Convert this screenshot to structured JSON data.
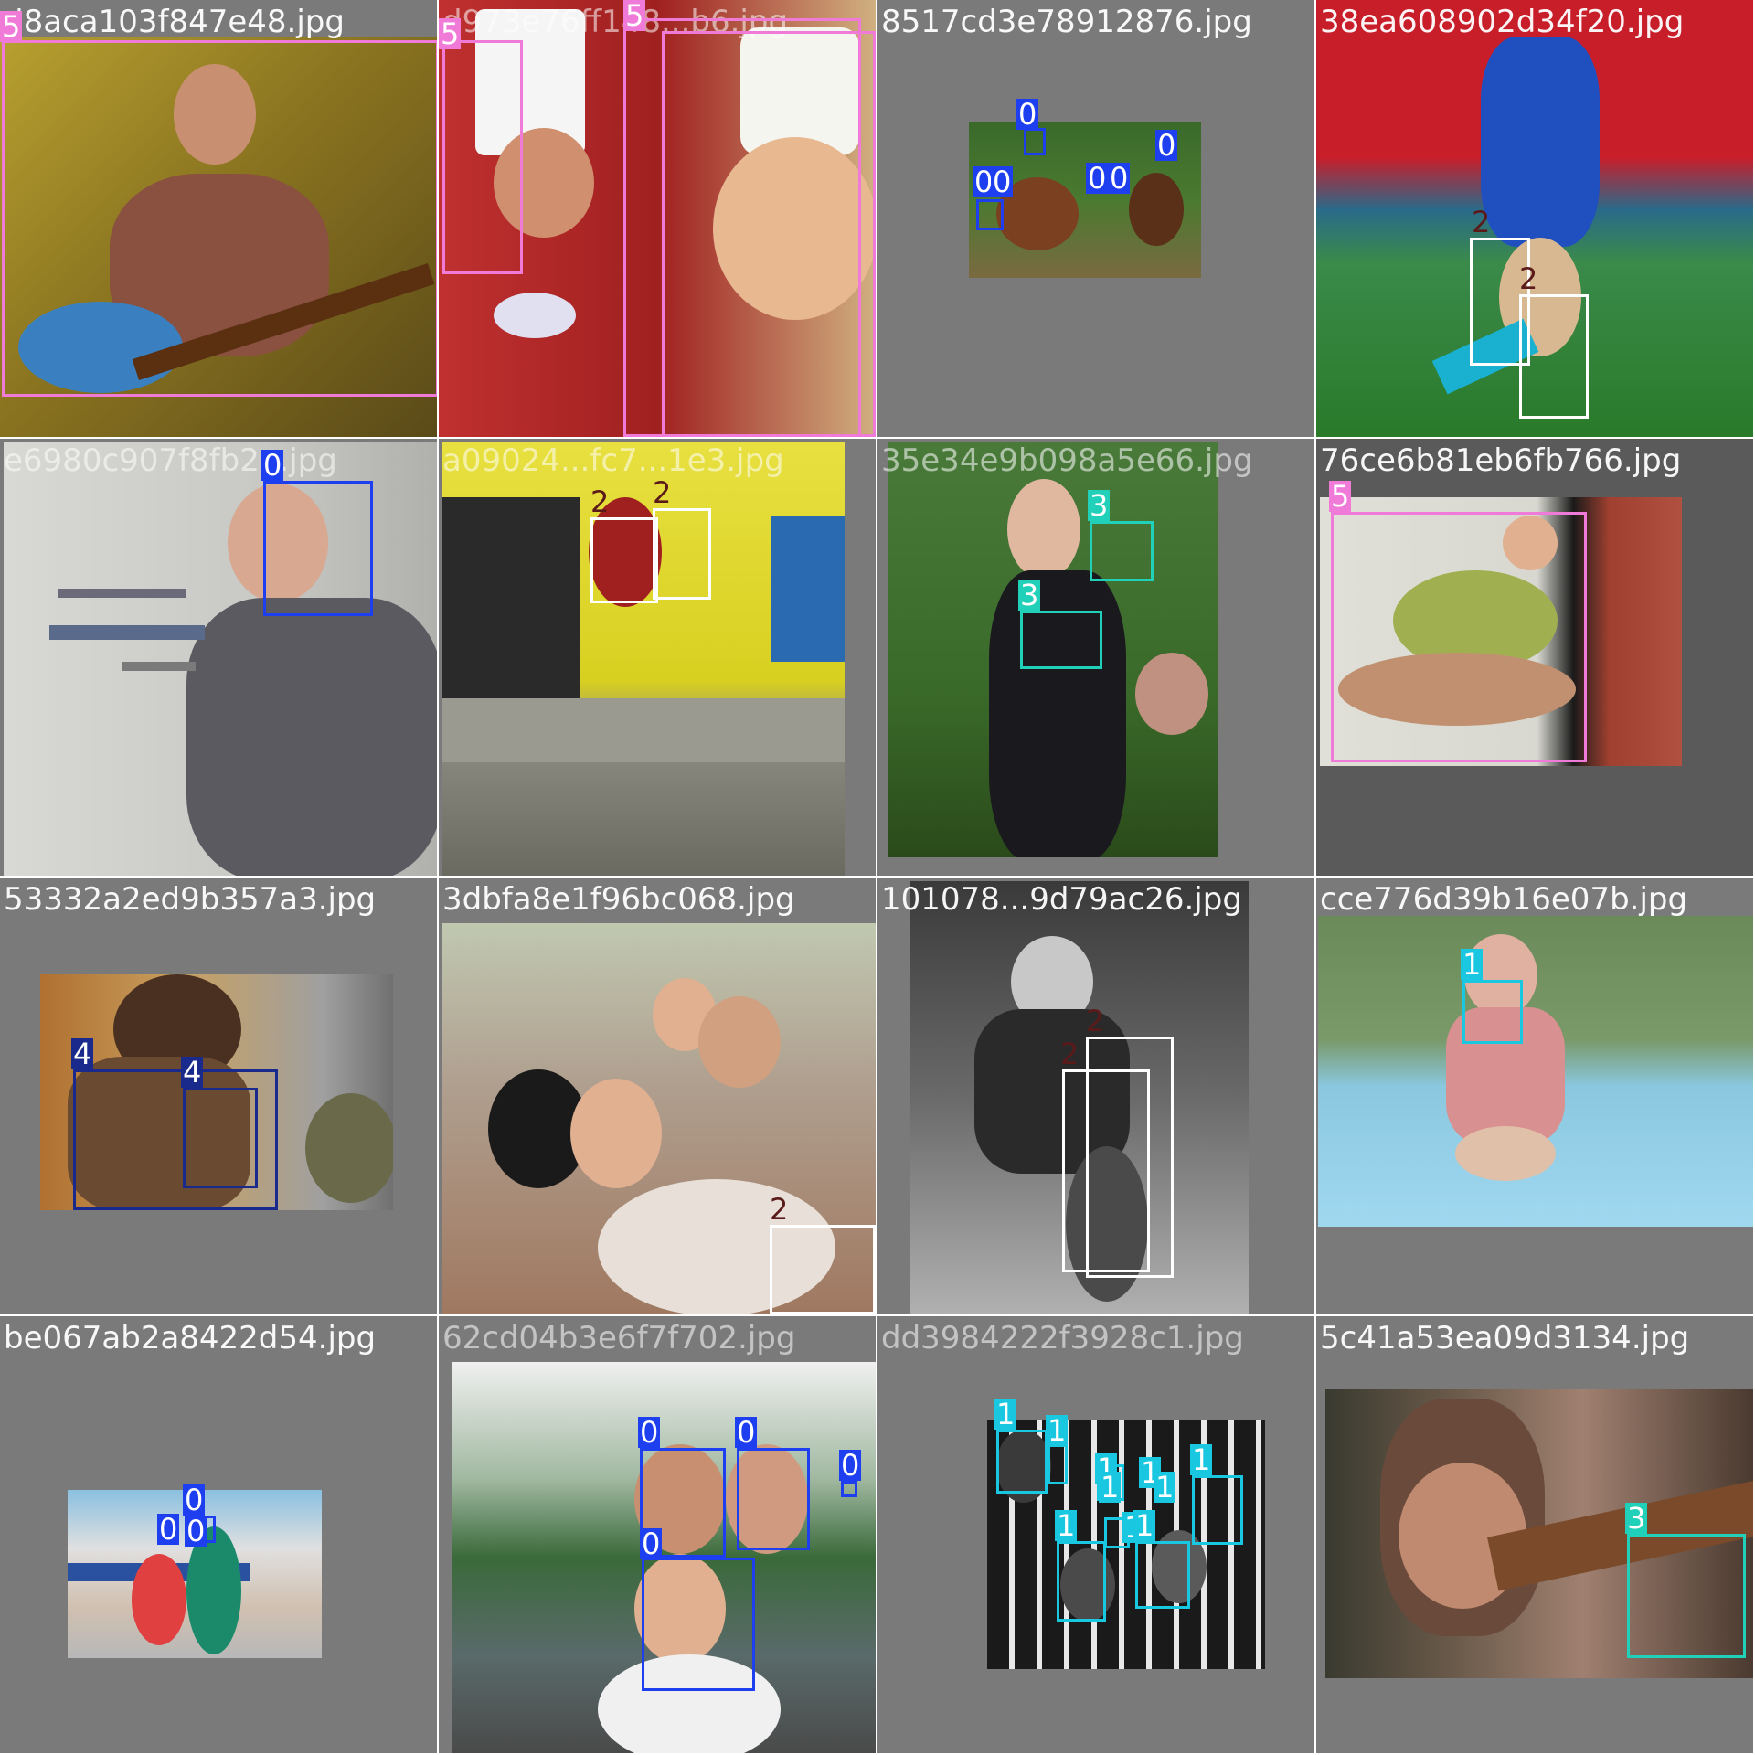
{
  "grid": {
    "columns": 4,
    "rows": 4,
    "tiles": [
      {
        "filename": "d8aca103f847e48.jpg",
        "class_labels": [
          "5"
        ]
      },
      {
        "filename": "d973e76ff148...b6.jpg",
        "class_labels": [
          "5",
          "5"
        ]
      },
      {
        "filename": "8517cd3e78912876.jpg",
        "class_labels": [
          "0",
          "0",
          "0",
          "0",
          "0",
          "0"
        ]
      },
      {
        "filename": "38ea608902d34f20.jpg",
        "class_labels": [
          "2",
          "2"
        ]
      },
      {
        "filename": "e6980c907f8fb2...jpg",
        "class_labels": [
          "0"
        ]
      },
      {
        "filename": "a09024...fc7...1e3.jpg",
        "class_labels": [
          "2",
          "2"
        ]
      },
      {
        "filename": "35e34e9b098a5e66.jpg",
        "class_labels": [
          "3",
          "3"
        ]
      },
      {
        "filename": "76ce6b81eb6fb766.jpg",
        "class_labels": [
          "5"
        ]
      },
      {
        "filename": "53332a2ed9b357a3.jpg",
        "class_labels": [
          "4",
          "4"
        ]
      },
      {
        "filename": "3dbfa8e1f96bc068.jpg",
        "class_labels": [
          "2"
        ]
      },
      {
        "filename": "101078...9d79ac26.jpg",
        "class_labels": [
          "2",
          "2"
        ]
      },
      {
        "filename": "cce776d39b16e07b.jpg",
        "class_labels": [
          "1"
        ]
      },
      {
        "filename": "be067ab2a8422d54.jpg",
        "class_labels": [
          "0",
          "0",
          "0"
        ]
      },
      {
        "filename": "62cd04b3e6f7f702.jpg",
        "class_labels": [
          "0",
          "0",
          "0",
          "0"
        ]
      },
      {
        "filename": "dd3984222f3928c1.jpg",
        "class_labels": [
          "1",
          "1",
          "1",
          "1",
          "1",
          "1",
          "1",
          "1",
          "1",
          "1"
        ]
      },
      {
        "filename": "5c41a53ea09d3134.jpg",
        "class_labels": [
          "3"
        ]
      }
    ]
  },
  "colors": {
    "class_0": "#1e3ff0",
    "class_1": "#19c8e0",
    "class_2": "#ffffff",
    "class_3": "#20d0b8",
    "class_4": "#1a2a8c",
    "class_5": "#f07ad8",
    "tile_background": "#7a7a7a",
    "grid_line": "#ffffff"
  }
}
